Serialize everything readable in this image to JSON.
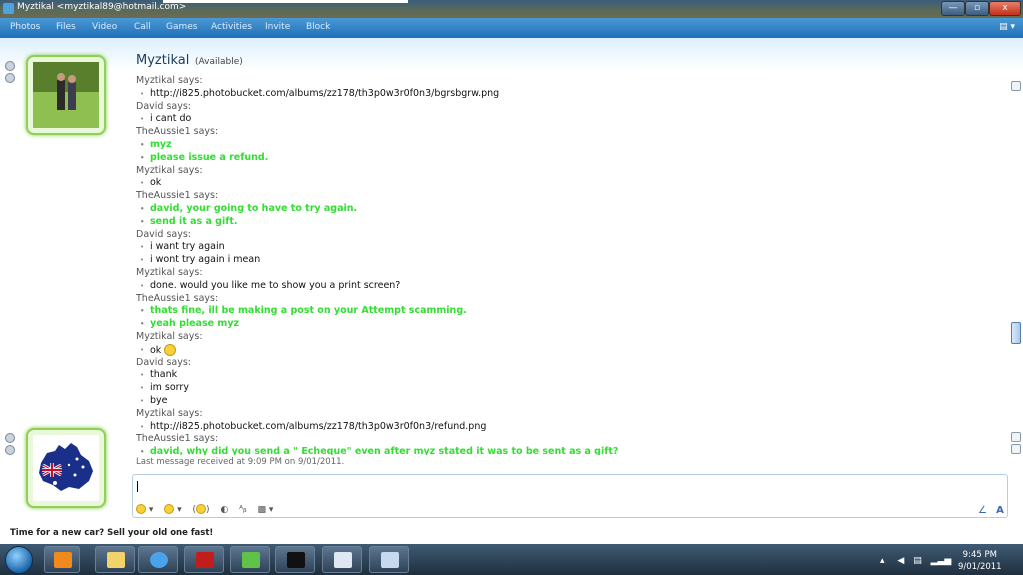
{
  "window": {
    "title": "Myztikal <myztikal89@hotmail.com>"
  },
  "window_controls": {
    "minimize": "—",
    "maximize": "▫",
    "close": "x"
  },
  "menu": {
    "items": [
      "Photos",
      "Files",
      "Video",
      "Call",
      "Games",
      "Activities",
      "Invite",
      "Block"
    ],
    "options_glyph": "▤ ▾"
  },
  "contact": {
    "name": "Myztikal",
    "status": "(Available)"
  },
  "conversation": [
    {
      "type": "says",
      "text": "Myztikal says:"
    },
    {
      "type": "msg",
      "text": "http://i825.photobucket.com/albums/zz178/th3p0w3r0f0n3/bgrsbgrw.png"
    },
    {
      "type": "says",
      "text": "David says:"
    },
    {
      "type": "msg",
      "text": "i cant do"
    },
    {
      "type": "says",
      "text": "TheAussie1 says:"
    },
    {
      "type": "green",
      "text": "myz"
    },
    {
      "type": "green",
      "text": "please issue a refund."
    },
    {
      "type": "says",
      "text": "Myztikal says:"
    },
    {
      "type": "msg",
      "text": "ok"
    },
    {
      "type": "says",
      "text": "TheAussie1 says:"
    },
    {
      "type": "green",
      "text": "david, your going to have to try again."
    },
    {
      "type": "green",
      "text": "send it as a gift."
    },
    {
      "type": "says",
      "text": "David says:"
    },
    {
      "type": "msg",
      "text": "i want try again"
    },
    {
      "type": "msg",
      "text": "i wont try again i mean"
    },
    {
      "type": "says",
      "text": "Myztikal says:"
    },
    {
      "type": "msg",
      "text": "done. would you like me to show you a print screen?"
    },
    {
      "type": "says",
      "text": "TheAussie1 says:"
    },
    {
      "type": "green",
      "text": "thats fine, ill be making a post on your Attempt scamming."
    },
    {
      "type": "green",
      "text": "yeah please myz"
    },
    {
      "type": "says",
      "text": "Myztikal says:"
    },
    {
      "type": "msg",
      "text": "ok",
      "emoticon": true
    },
    {
      "type": "says",
      "text": "David says:"
    },
    {
      "type": "msg",
      "text": "thank"
    },
    {
      "type": "msg",
      "text": "im sorry"
    },
    {
      "type": "msg",
      "text": "bye"
    },
    {
      "type": "says",
      "text": "Myztikal says:"
    },
    {
      "type": "msg",
      "text": "http://i825.photobucket.com/albums/zz178/th3p0w3r0f0n3/refund.png"
    },
    {
      "type": "says",
      "text": "TheAussie1 says:"
    },
    {
      "type": "green",
      "text": "david, why did you send a \" Echeque\" even after myz stated it was to be sent as a gift?"
    }
  ],
  "last_message": "Last message received at 9:09 PM on 9/01/2011.",
  "input": {
    "value": ""
  },
  "ad": {
    "text": "Time for a new car? Sell your old one fast!"
  },
  "clock": {
    "time": "9:45 PM",
    "date": "9/01/2011"
  },
  "taskbar_icons": [
    "media-player-icon",
    "explorer-icon",
    "internet-explorer-icon",
    "pdf-reader-icon",
    "messenger-icon",
    "command-prompt-icon",
    "window-app-icon",
    "paint-icon"
  ]
}
